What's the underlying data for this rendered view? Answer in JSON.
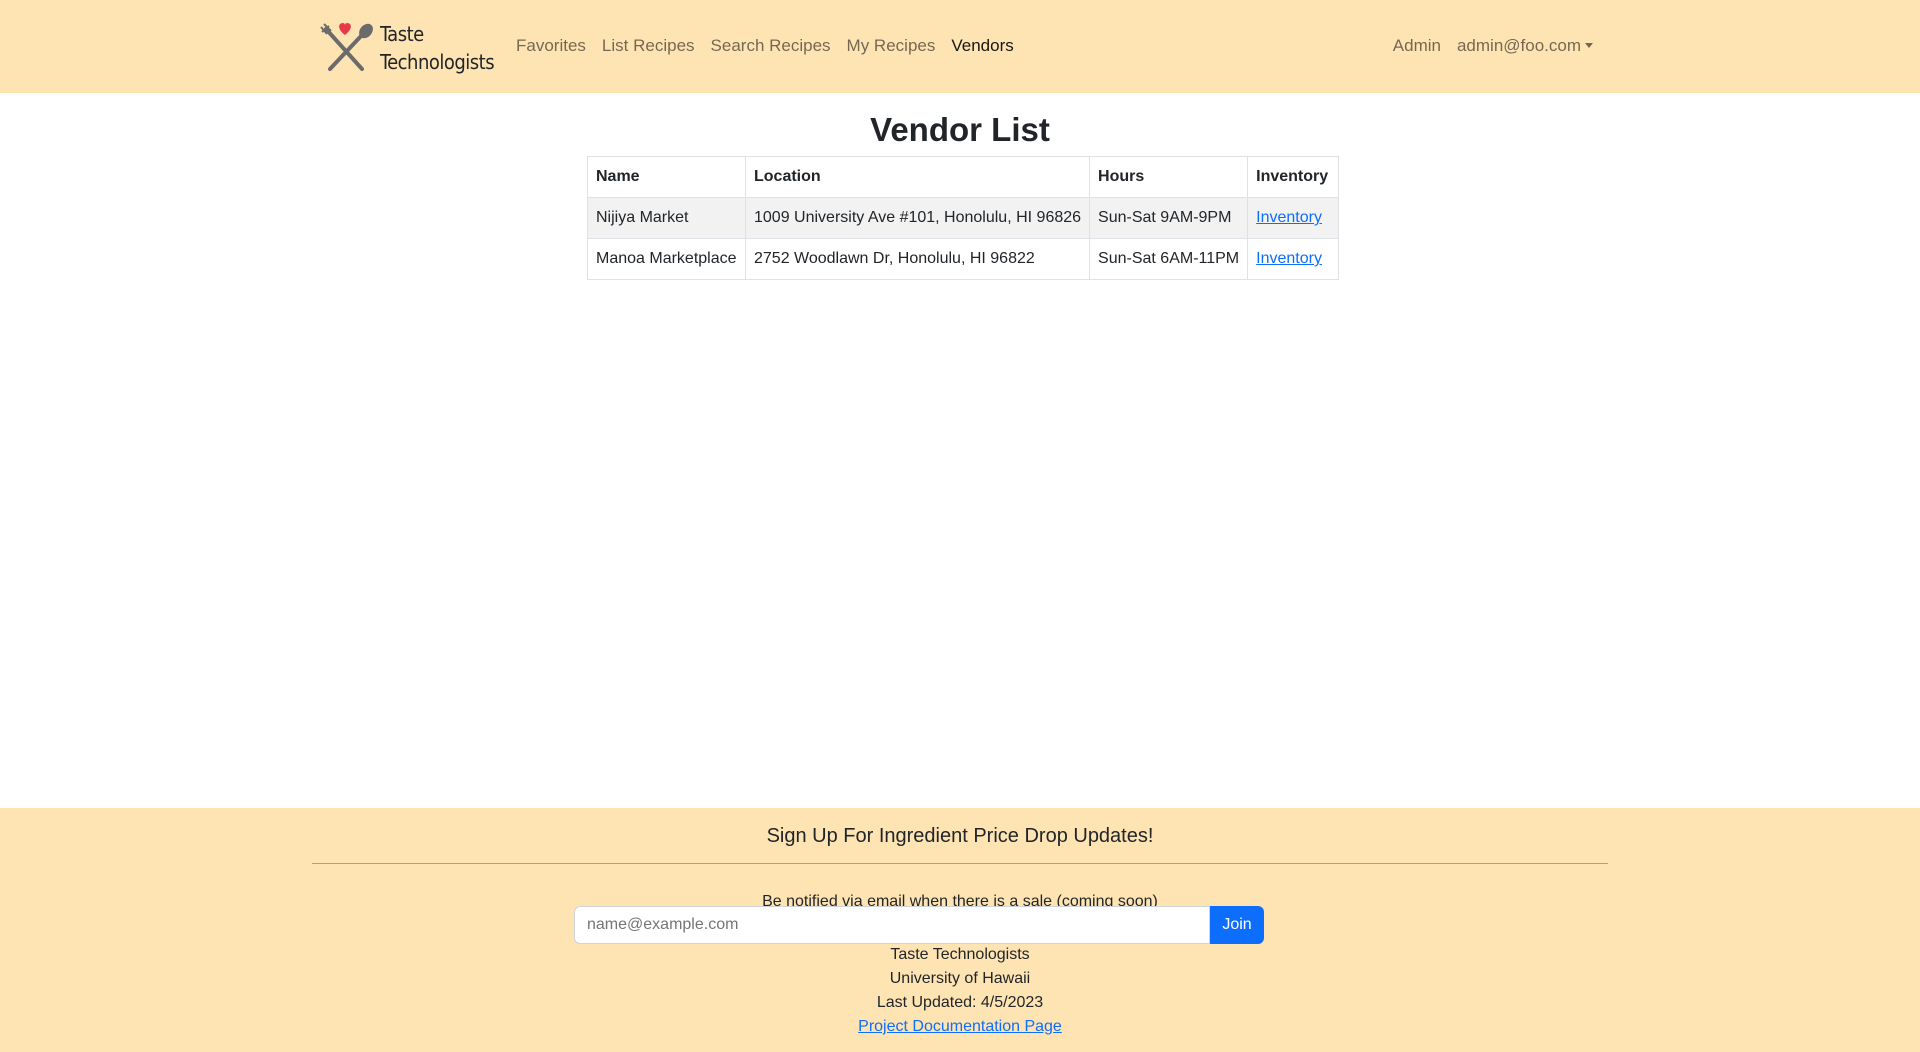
{
  "navbar": {
    "brand": {
      "logo_icon": "crossed-fork-spoon-heart-icon",
      "line1": "Taste",
      "line2": "Technologists"
    },
    "links": [
      {
        "label": "Favorites",
        "active": false
      },
      {
        "label": "List Recipes",
        "active": false
      },
      {
        "label": "Search Recipes",
        "active": false
      },
      {
        "label": "My Recipes",
        "active": false
      },
      {
        "label": "Vendors",
        "active": true
      }
    ],
    "admin_label": "Admin",
    "user_menu_label": "admin@foo.com"
  },
  "main": {
    "title": "Vendor List",
    "table": {
      "headers": [
        "Name",
        "Location",
        "Hours",
        "Inventory"
      ],
      "rows": [
        {
          "name": "Nijiya Market",
          "location": "1009 University Ave #101, Honolulu, HI 96826",
          "hours": "Sun-Sat 9AM-9PM",
          "inventory_link": "Inventory"
        },
        {
          "name": "Manoa Marketplace",
          "location": "2752 Woodlawn Dr, Honolulu, HI 96822",
          "hours": "Sun-Sat 6AM-11PM",
          "inventory_link": "Inventory"
        }
      ]
    }
  },
  "footer": {
    "heading": "Sign Up For Ingredient Price Drop Updates!",
    "notify_text": "Be notified via email when there is a sale (coming soon)",
    "email_placeholder": "name@example.com",
    "join_label": "Join",
    "org_name": "Taste Technologists",
    "university": "University of Hawaii",
    "last_updated": "Last Updated: 4/5/2023",
    "docs_link": "Project Documentation Page"
  },
  "colors": {
    "header_footer_bg": "#ffe4b3",
    "primary": "#0d6efd",
    "logo_heart": "#e8394b",
    "logo_utensils": "#6b6b6b"
  }
}
